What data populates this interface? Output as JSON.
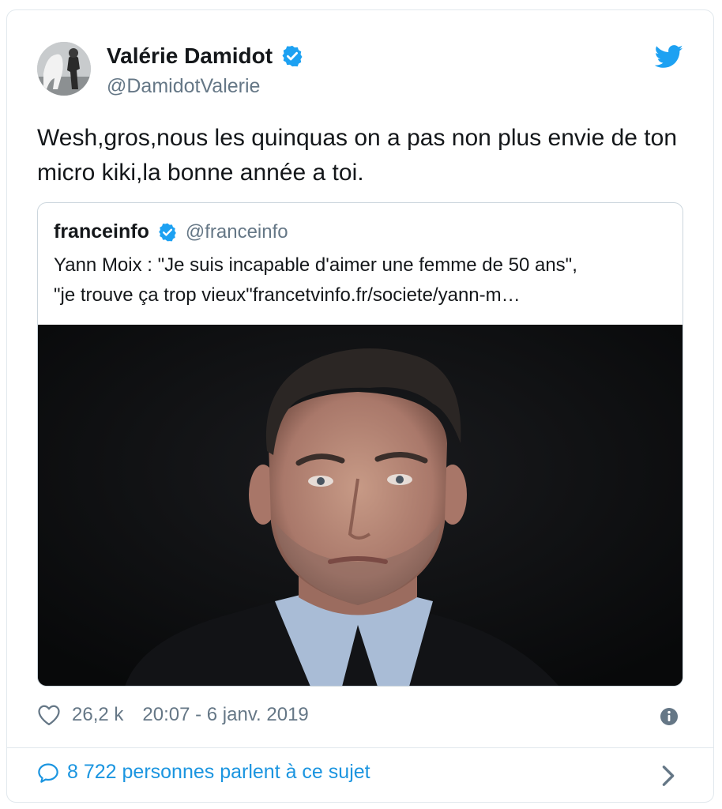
{
  "author": {
    "name": "Valérie Damidot",
    "handle": "@DamidotValerie",
    "verified": true
  },
  "tweet": {
    "text": "Wesh,gros,nous les quinquas on a pas non plus envie de ton micro kiki,la bonne année a toi."
  },
  "quoted_tweet": {
    "name": "franceinfo",
    "handle": "@franceinfo",
    "verified": true,
    "text": "Yann Moix : \"Je suis incapable d'aimer une femme de 50 ans\",\n\"je trouve ça trop vieux\"francetvinfo.fr/societe/yann-m…"
  },
  "footer": {
    "likes": "26,2 k",
    "timestamp": "20:07 - 6 janv. 2019",
    "discussion": "8 722 personnes parlent à ce sujet"
  },
  "colors": {
    "twitter_blue": "#1da1f2",
    "link_blue": "#1b95e0",
    "text": "#14171a",
    "muted": "#657786",
    "border": "#e1e8ed"
  },
  "icons": {
    "brand": "twitter-bird-icon",
    "verified": "verified-badge-icon",
    "like": "heart-icon",
    "info": "info-icon",
    "discussion": "speech-bubble-icon",
    "more": "chevron-right-icon"
  }
}
